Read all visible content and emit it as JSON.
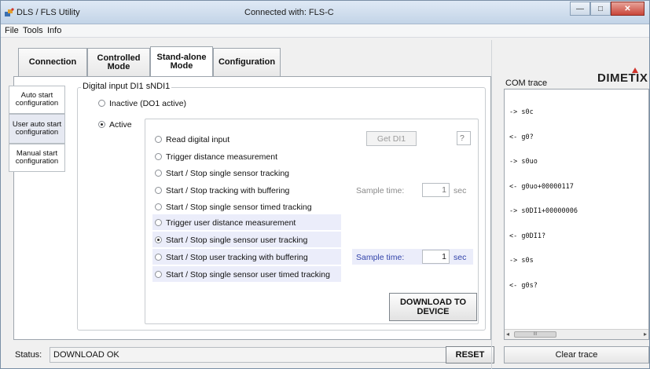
{
  "window": {
    "title": "DLS / FLS Utility",
    "connection_status": "Connected with: FLS-C",
    "minimize_glyph": "—",
    "maximize_glyph": "□",
    "close_glyph": "✕"
  },
  "menu": {
    "file": "File",
    "tools": "Tools",
    "info": "Info"
  },
  "tabs": {
    "connection": "Connection",
    "controlled_mode": "Controlled Mode",
    "standalone_mode": "Stand-alone Mode",
    "configuration": "Configuration",
    "active": "standalone_mode"
  },
  "sidebar": {
    "auto_start": "Auto start configuration",
    "user_auto_start": "User auto start configuration",
    "manual_start": "Manual start configuration",
    "active": "user_auto_start"
  },
  "digital_input": {
    "group_title": "Digital input DI1 sNDI1",
    "inactive_label": "Inactive (DO1 active)",
    "active_label": "Active",
    "selected_mode": "active",
    "options": [
      "Read digital input",
      "Trigger distance measurement",
      "Start / Stop single sensor tracking",
      "Start / Stop tracking with buffering",
      "Start / Stop single sensor timed tracking",
      "Trigger user distance measurement",
      "Start / Stop single sensor user tracking",
      "Start / Stop user tracking with buffering",
      "Start / Stop single sensor user timed tracking"
    ],
    "selected_option": 6,
    "get_button": "Get DI1",
    "di_value": "?",
    "sample_time_label": "Sample time:",
    "sample_time_value": "1",
    "sample_time_unit": "sec",
    "user_sample_time_label": "Sample time:",
    "user_sample_time_value": "1",
    "user_sample_time_unit": "sec"
  },
  "download_button": "DOWNLOAD TO DEVICE",
  "status": {
    "label": "Status:",
    "value": "DOWNLOAD OK"
  },
  "reset_button": "RESET",
  "trace": {
    "label": "COM trace",
    "logo": "DIMETIX",
    "lines": [
      "-> s0c",
      "<- g0?",
      "-> s0uo",
      "<- g0uo+00000117",
      "-> s0DI1+00000006",
      "<- g0DI1?",
      "-> s0s",
      "<- g0s?"
    ],
    "scroll_mark": "III",
    "clear_button": "Clear trace"
  }
}
